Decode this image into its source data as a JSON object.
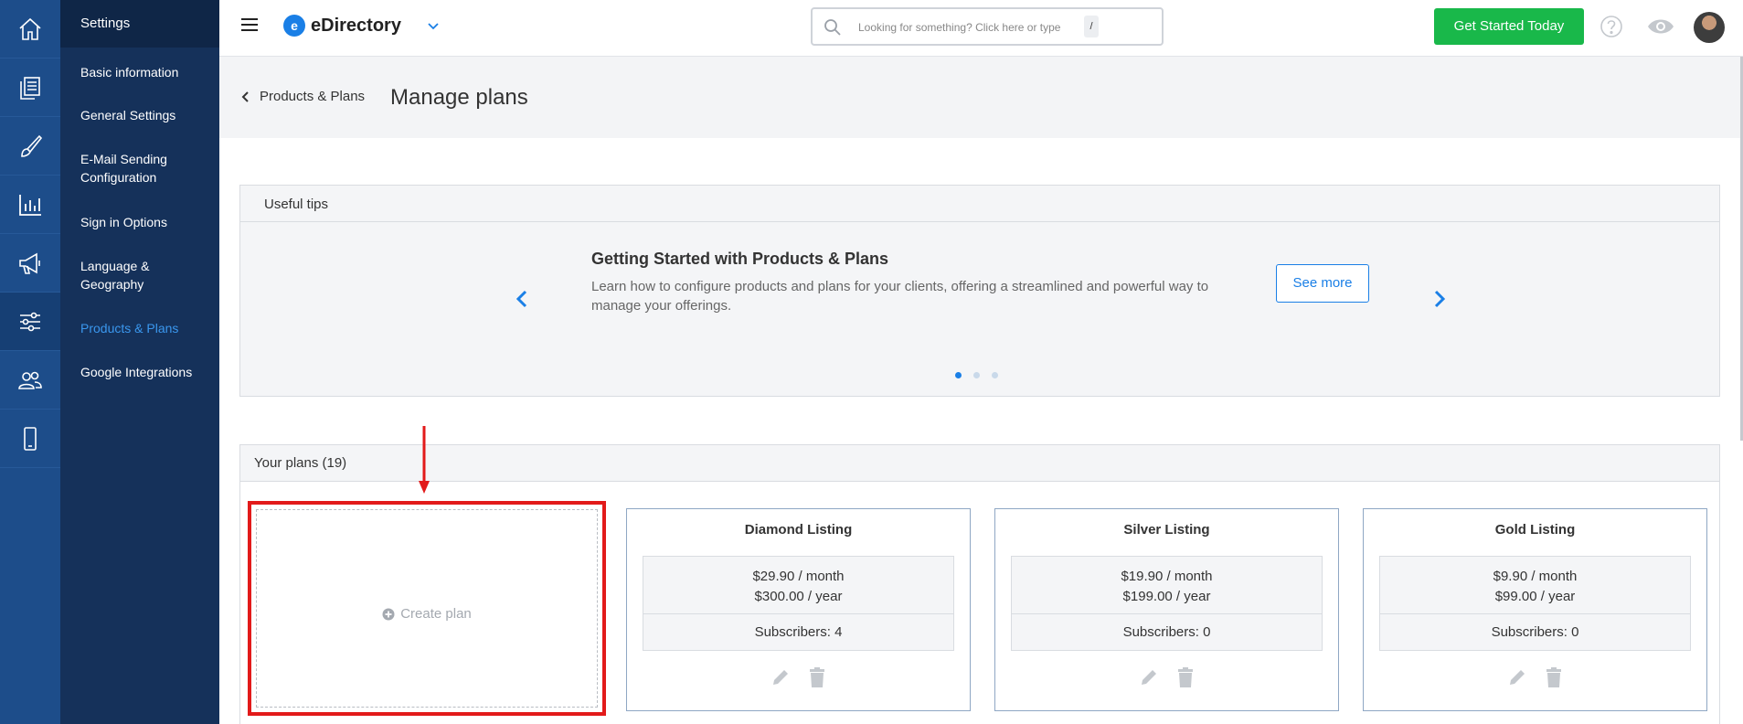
{
  "rail": {
    "items": [
      {
        "icon": "home-icon"
      },
      {
        "icon": "pages-icon"
      },
      {
        "icon": "brush-icon"
      },
      {
        "icon": "chart-icon"
      },
      {
        "icon": "megaphone-icon"
      },
      {
        "icon": "sliders-icon",
        "active": true
      },
      {
        "icon": "users-icon"
      },
      {
        "icon": "mobile-icon"
      }
    ]
  },
  "menu": {
    "title": "Settings",
    "items": [
      {
        "label": "Basic information"
      },
      {
        "label": "General Settings"
      },
      {
        "label": "E-Mail Sending Configuration"
      },
      {
        "label": "Sign in Options"
      },
      {
        "label": "Language & Geography"
      },
      {
        "label": "Products & Plans",
        "active": true
      },
      {
        "label": "Google Integrations"
      }
    ]
  },
  "topbar": {
    "brand_initial": "e",
    "brand_name": "eDirectory",
    "search_placeholder": "Looking for something? Click here or type",
    "search_shortcut": "/",
    "cta_label": "Get Started Today"
  },
  "page": {
    "breadcrumb": "Products & Plans",
    "title": "Manage plans"
  },
  "tips": {
    "header": "Useful tips",
    "title": "Getting Started with Products & Plans",
    "text": "Learn how to configure products and plans for your clients, offering a streamlined and powerful way to manage your offerings.",
    "button": "See more",
    "slide_count": 3,
    "active_slide": 1
  },
  "plans": {
    "header": "Your plans (19)",
    "create_label": "Create plan",
    "items": [
      {
        "name": "Diamond Listing",
        "monthly": "$29.90 / month",
        "yearly": "$300.00 / year",
        "subscribers": "Subscribers: 4"
      },
      {
        "name": "Silver Listing",
        "monthly": "$19.90 / month",
        "yearly": "$199.00 / year",
        "subscribers": "Subscribers: 0"
      },
      {
        "name": "Gold Listing",
        "monthly": "$9.90 / month",
        "yearly": "$99.00 / year",
        "subscribers": "Subscribers: 0"
      }
    ]
  },
  "colors": {
    "rail": "#1d4d8a",
    "menu": "#15315a",
    "accent": "#1a7fe6",
    "cta": "#19b84a",
    "highlight": "#e21a1a"
  }
}
